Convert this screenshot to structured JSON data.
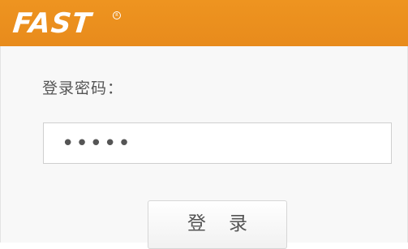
{
  "header": {
    "logo_text": "FAST",
    "logo_mark": "R",
    "brand_color": "#e98d1d"
  },
  "login": {
    "password_label": "登录密码：",
    "password_value": "•••••",
    "submit_label": "登录"
  }
}
